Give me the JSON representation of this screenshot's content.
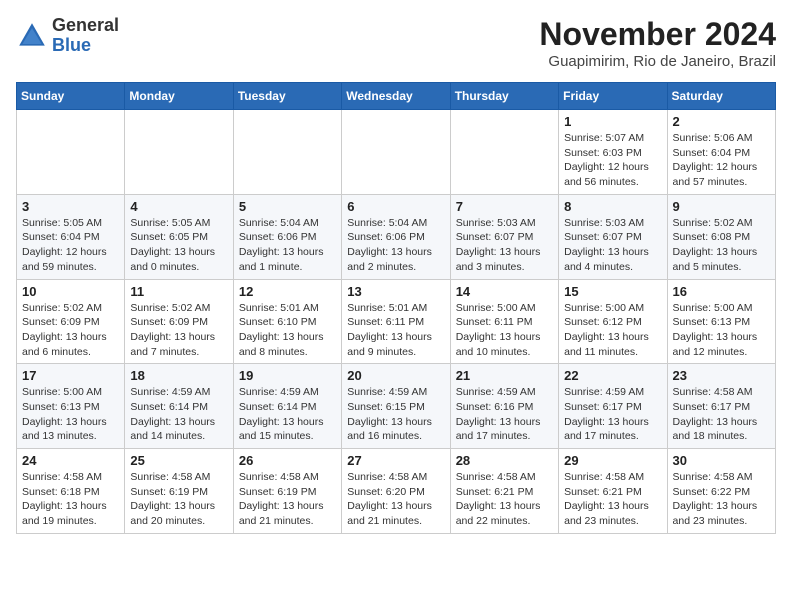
{
  "header": {
    "logo_general": "General",
    "logo_blue": "Blue",
    "month_title": "November 2024",
    "location": "Guapimirim, Rio de Janeiro, Brazil"
  },
  "weekdays": [
    "Sunday",
    "Monday",
    "Tuesday",
    "Wednesday",
    "Thursday",
    "Friday",
    "Saturday"
  ],
  "weeks": [
    [
      {
        "day": "",
        "info": ""
      },
      {
        "day": "",
        "info": ""
      },
      {
        "day": "",
        "info": ""
      },
      {
        "day": "",
        "info": ""
      },
      {
        "day": "",
        "info": ""
      },
      {
        "day": "1",
        "info": "Sunrise: 5:07 AM\nSunset: 6:03 PM\nDaylight: 12 hours and 56 minutes."
      },
      {
        "day": "2",
        "info": "Sunrise: 5:06 AM\nSunset: 6:04 PM\nDaylight: 12 hours and 57 minutes."
      }
    ],
    [
      {
        "day": "3",
        "info": "Sunrise: 5:05 AM\nSunset: 6:04 PM\nDaylight: 12 hours and 59 minutes."
      },
      {
        "day": "4",
        "info": "Sunrise: 5:05 AM\nSunset: 6:05 PM\nDaylight: 13 hours and 0 minutes."
      },
      {
        "day": "5",
        "info": "Sunrise: 5:04 AM\nSunset: 6:06 PM\nDaylight: 13 hours and 1 minute."
      },
      {
        "day": "6",
        "info": "Sunrise: 5:04 AM\nSunset: 6:06 PM\nDaylight: 13 hours and 2 minutes."
      },
      {
        "day": "7",
        "info": "Sunrise: 5:03 AM\nSunset: 6:07 PM\nDaylight: 13 hours and 3 minutes."
      },
      {
        "day": "8",
        "info": "Sunrise: 5:03 AM\nSunset: 6:07 PM\nDaylight: 13 hours and 4 minutes."
      },
      {
        "day": "9",
        "info": "Sunrise: 5:02 AM\nSunset: 6:08 PM\nDaylight: 13 hours and 5 minutes."
      }
    ],
    [
      {
        "day": "10",
        "info": "Sunrise: 5:02 AM\nSunset: 6:09 PM\nDaylight: 13 hours and 6 minutes."
      },
      {
        "day": "11",
        "info": "Sunrise: 5:02 AM\nSunset: 6:09 PM\nDaylight: 13 hours and 7 minutes."
      },
      {
        "day": "12",
        "info": "Sunrise: 5:01 AM\nSunset: 6:10 PM\nDaylight: 13 hours and 8 minutes."
      },
      {
        "day": "13",
        "info": "Sunrise: 5:01 AM\nSunset: 6:11 PM\nDaylight: 13 hours and 9 minutes."
      },
      {
        "day": "14",
        "info": "Sunrise: 5:00 AM\nSunset: 6:11 PM\nDaylight: 13 hours and 10 minutes."
      },
      {
        "day": "15",
        "info": "Sunrise: 5:00 AM\nSunset: 6:12 PM\nDaylight: 13 hours and 11 minutes."
      },
      {
        "day": "16",
        "info": "Sunrise: 5:00 AM\nSunset: 6:13 PM\nDaylight: 13 hours and 12 minutes."
      }
    ],
    [
      {
        "day": "17",
        "info": "Sunrise: 5:00 AM\nSunset: 6:13 PM\nDaylight: 13 hours and 13 minutes."
      },
      {
        "day": "18",
        "info": "Sunrise: 4:59 AM\nSunset: 6:14 PM\nDaylight: 13 hours and 14 minutes."
      },
      {
        "day": "19",
        "info": "Sunrise: 4:59 AM\nSunset: 6:14 PM\nDaylight: 13 hours and 15 minutes."
      },
      {
        "day": "20",
        "info": "Sunrise: 4:59 AM\nSunset: 6:15 PM\nDaylight: 13 hours and 16 minutes."
      },
      {
        "day": "21",
        "info": "Sunrise: 4:59 AM\nSunset: 6:16 PM\nDaylight: 13 hours and 17 minutes."
      },
      {
        "day": "22",
        "info": "Sunrise: 4:59 AM\nSunset: 6:17 PM\nDaylight: 13 hours and 17 minutes."
      },
      {
        "day": "23",
        "info": "Sunrise: 4:58 AM\nSunset: 6:17 PM\nDaylight: 13 hours and 18 minutes."
      }
    ],
    [
      {
        "day": "24",
        "info": "Sunrise: 4:58 AM\nSunset: 6:18 PM\nDaylight: 13 hours and 19 minutes."
      },
      {
        "day": "25",
        "info": "Sunrise: 4:58 AM\nSunset: 6:19 PM\nDaylight: 13 hours and 20 minutes."
      },
      {
        "day": "26",
        "info": "Sunrise: 4:58 AM\nSunset: 6:19 PM\nDaylight: 13 hours and 21 minutes."
      },
      {
        "day": "27",
        "info": "Sunrise: 4:58 AM\nSunset: 6:20 PM\nDaylight: 13 hours and 21 minutes."
      },
      {
        "day": "28",
        "info": "Sunrise: 4:58 AM\nSunset: 6:21 PM\nDaylight: 13 hours and 22 minutes."
      },
      {
        "day": "29",
        "info": "Sunrise: 4:58 AM\nSunset: 6:21 PM\nDaylight: 13 hours and 23 minutes."
      },
      {
        "day": "30",
        "info": "Sunrise: 4:58 AM\nSunset: 6:22 PM\nDaylight: 13 hours and 23 minutes."
      }
    ]
  ]
}
